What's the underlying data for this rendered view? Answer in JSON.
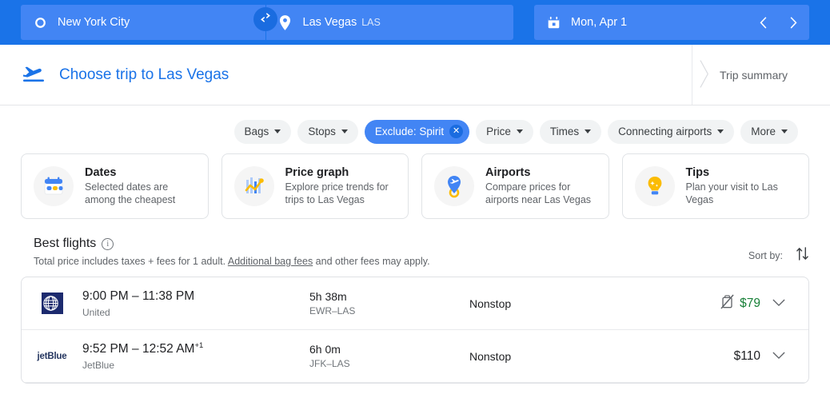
{
  "search_bar": {
    "origin": {
      "icon": "origin-circle-icon",
      "value": "New York City"
    },
    "swap": {
      "icon": "swap-icon"
    },
    "destination": {
      "icon": "location-pin-icon",
      "value": "Las Vegas",
      "code": "LAS"
    },
    "date": {
      "icon": "calendar-icon",
      "value": "Mon, Apr 1"
    },
    "prev_label": "‹",
    "next_label": "›",
    "colors": {
      "bar": "#1a73e8",
      "field": "#4285f4",
      "swap_button": "#1a6ce0"
    }
  },
  "header": {
    "icon": "plane-takeoff-icon",
    "title": "Choose trip to Las Vegas",
    "trip_summary": "Trip summary"
  },
  "filters": {
    "chips": [
      {
        "label": "Bags",
        "type": "dropdown",
        "active": false
      },
      {
        "label": "Stops",
        "type": "dropdown",
        "active": false
      },
      {
        "label": "Exclude: Spirit",
        "type": "removable",
        "active": true
      },
      {
        "label": "Price",
        "type": "dropdown",
        "active": false
      },
      {
        "label": "Times",
        "type": "dropdown",
        "active": false
      },
      {
        "label": "Connecting airports",
        "type": "dropdown",
        "active": false
      },
      {
        "label": "More",
        "type": "dropdown",
        "active": false
      }
    ],
    "remove_glyph": "✕"
  },
  "cards": [
    {
      "icon": "calendar-dates-icon",
      "title": "Dates",
      "subtitle": "Selected dates are among the cheapest"
    },
    {
      "icon": "price-graph-icon",
      "title": "Price graph",
      "subtitle": "Explore price trends for trips to Las Vegas"
    },
    {
      "icon": "airport-pin-icon",
      "title": "Airports",
      "subtitle": "Compare prices for airports near Las Vegas"
    },
    {
      "icon": "lightbulb-icon",
      "title": "Tips",
      "subtitle": "Plan your visit to Las Vegas"
    }
  ],
  "best_flights": {
    "title": "Best flights",
    "info_glyph": "i",
    "disclaimer_before": "Total price includes taxes + fees for 1 adult. ",
    "disclaimer_link": "Additional bag fees",
    "disclaimer_after": " and other fees may apply.",
    "sort_label": "Sort by:",
    "sort_icon": "sort-arrows-icon"
  },
  "flights": [
    {
      "logo": "united-globe-logo",
      "time": "9:00 PM – 11:38 PM",
      "day_offset": "",
      "airline": "United",
      "duration": "5h 38m",
      "route": "EWR–LAS",
      "stops": "Nonstop",
      "bag_icon": "no-carry-on-bag-icon",
      "price": "$79",
      "price_color": "green",
      "expand_icon": "chevron-down-icon"
    },
    {
      "logo": "jetblue-wordmark-logo",
      "time": "9:52 PM – 12:52 AM",
      "day_offset": "+1",
      "airline": "JetBlue",
      "duration": "6h 0m",
      "route": "JFK–LAS",
      "stops": "Nonstop",
      "bag_icon": "",
      "price": "$110",
      "price_color": "dark",
      "expand_icon": "chevron-down-icon"
    }
  ]
}
